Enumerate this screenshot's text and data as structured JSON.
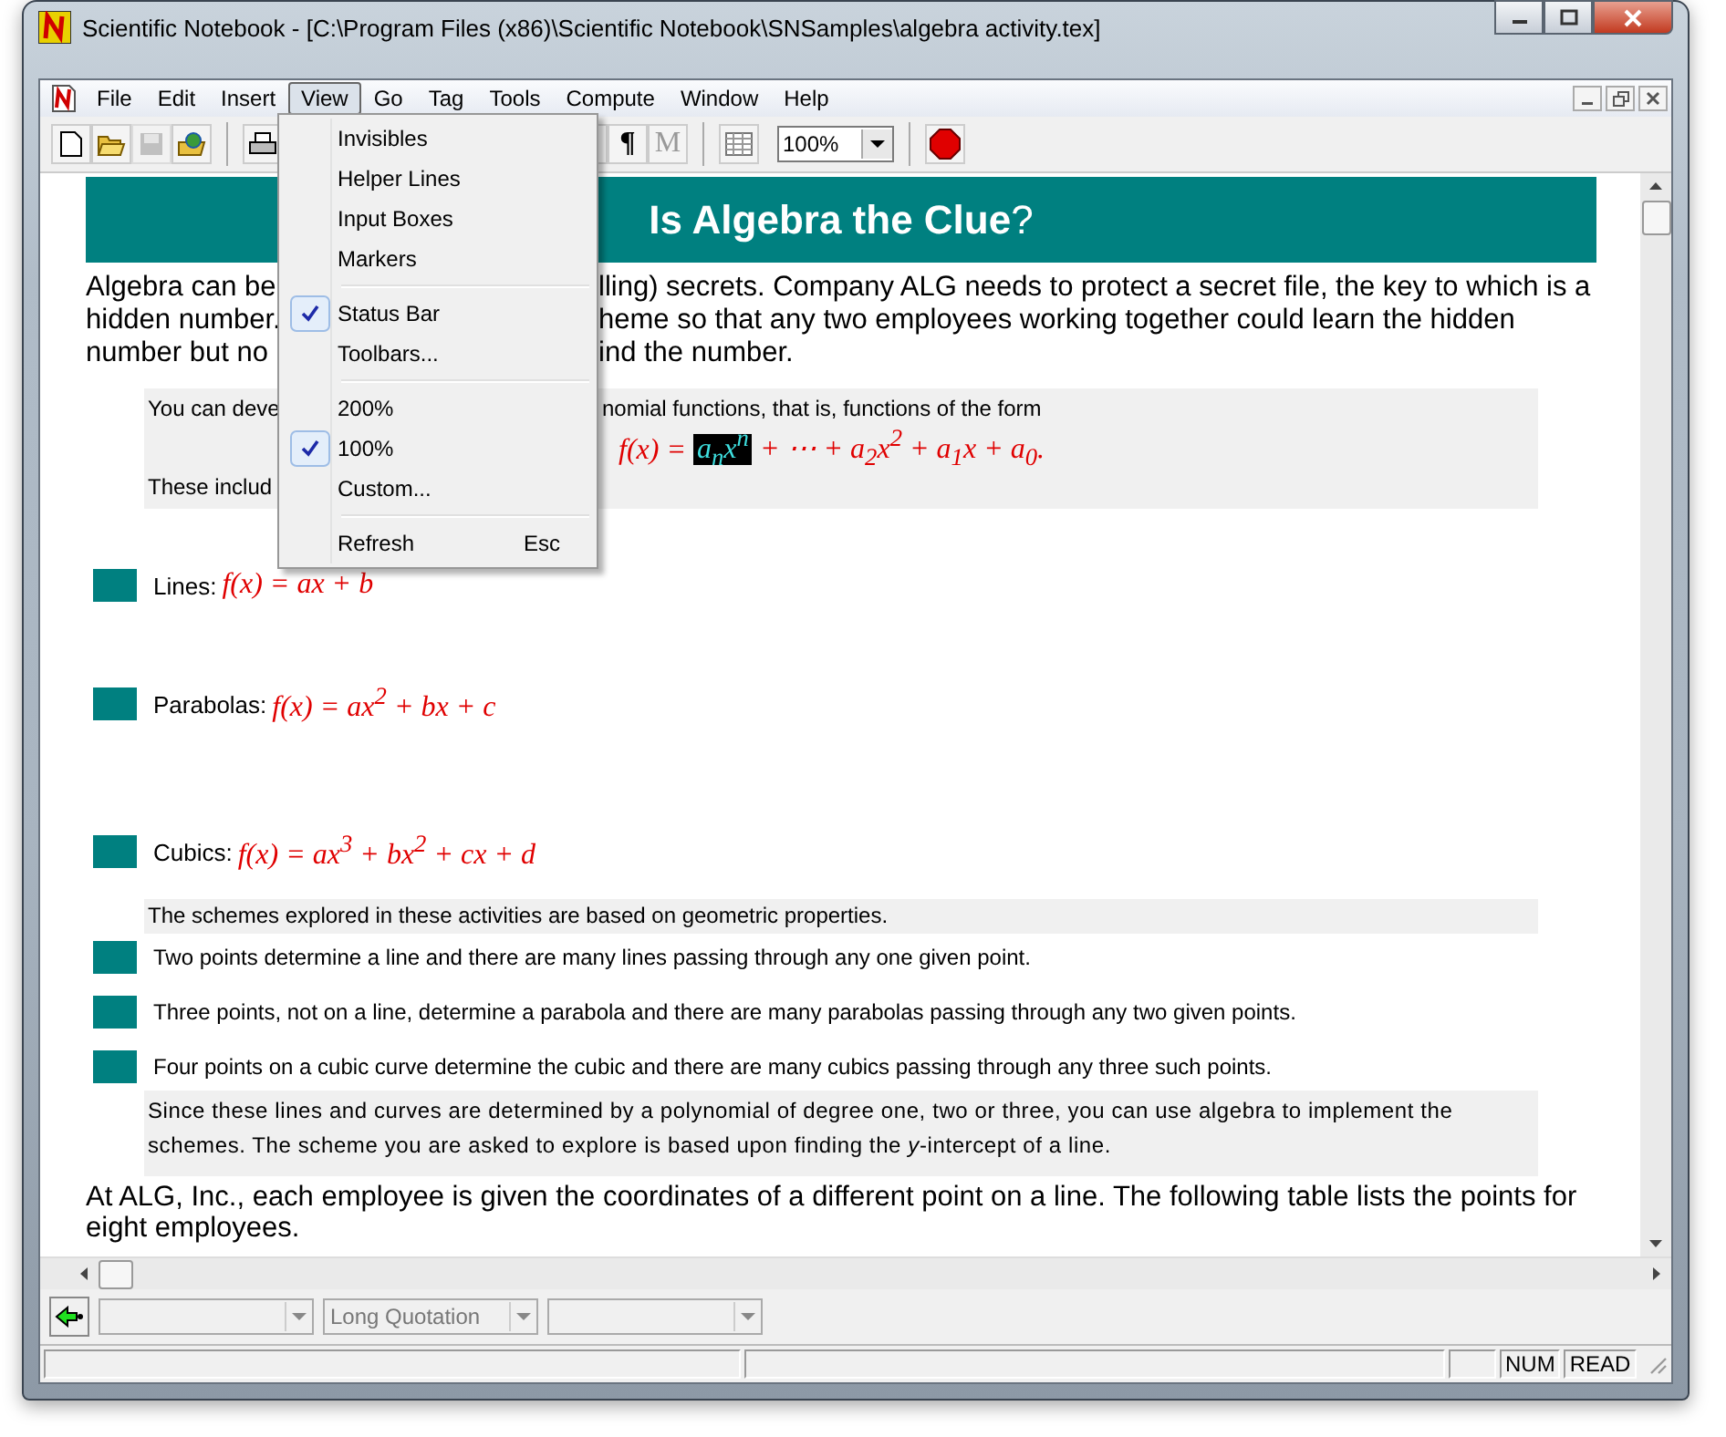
{
  "window": {
    "title": "Scientific Notebook - [C:\\Program Files (x86)\\Scientific Notebook\\SNSamples\\algebra activity.tex]"
  },
  "menu_bar": [
    {
      "label": "File",
      "selected": false
    },
    {
      "label": "Edit",
      "selected": false
    },
    {
      "label": "Insert",
      "selected": false
    },
    {
      "label": "View",
      "selected": true
    },
    {
      "label": "Go",
      "selected": false
    },
    {
      "label": "Tag",
      "selected": false
    },
    {
      "label": "Tools",
      "selected": false
    },
    {
      "label": "Compute",
      "selected": false
    },
    {
      "label": "Window",
      "selected": false
    },
    {
      "label": "Help",
      "selected": false
    }
  ],
  "toolbar": {
    "save_disabled": true,
    "text_buttons": [
      {
        "label": "¶",
        "disabled": false
      },
      {
        "label": "M",
        "disabled": true
      }
    ],
    "zoom": "100%"
  },
  "view_menu": {
    "groups": [
      [
        {
          "label": "Invisibles",
          "checked": false
        },
        {
          "label": "Helper Lines",
          "checked": false
        },
        {
          "label": "Input Boxes",
          "checked": false
        },
        {
          "label": "Markers",
          "checked": false
        }
      ],
      [
        {
          "label": "Status Bar",
          "checked": true
        },
        {
          "label": "Toolbars...",
          "checked": false
        }
      ],
      [
        {
          "label": "200%",
          "checked": false
        },
        {
          "label": "100%",
          "checked": true
        },
        {
          "label": "Custom...",
          "checked": false
        }
      ],
      [
        {
          "label": "Refresh",
          "checked": false,
          "shortcut": "Esc"
        }
      ]
    ]
  },
  "document": {
    "heading": "**Is Algebra the Clue**?",
    "intro": [
      {
        "left": "Algebra can be",
        "right": "lling) secrets. Company ALG needs to protect a secret file, the key to which is a"
      },
      {
        "left": "hidden number.",
        "right": "heme so that any two employees working together could learn the hidden"
      },
      {
        "left": "number but no",
        "right": "ind the number."
      }
    ],
    "note_box": {
      "line": {
        "left": "You can deve",
        "right": "nomial functions, that is, functions of the form"
      },
      "formula": [
        {
          "text": "f(x) = ",
          "selected": false
        },
        {
          "text": "a$_{n}$x$^{n}$",
          "selected": true
        },
        {
          "text": " + ⋯ + a$_{2}$x$^{2}$ + a$_{1}$x + a$_{0}$.",
          "selected": false
        }
      ],
      "after": "These includ"
    },
    "families": [
      {
        "label": "Lines:",
        "formula": "f(x) = ax + b"
      },
      {
        "label": "Parabolas:",
        "formula": "f(x) = ax$^{2}$ + bx + c"
      },
      {
        "label": "Cubics:",
        "formula": "f(x) = ax$^{3}$ + bx$^{2}$ + cx + d"
      }
    ],
    "schemes_note": "The schemes explored in these activities are based on geometric properties.",
    "schemes": [
      "Two points determine a line and there are many lines passing through any one given point.",
      "Three points, not on a line, determine a parabola and there are many parabolas passing through any two given points.",
      "Four points on a cubic curve determine the cubic and there are many cubics passing through any three such points."
    ],
    "since_note": "Since these lines and curves are determined by a polynomial of degree one, two or three, you can use algebra to implement the schemes. The scheme you are asked to explore is based upon finding the *y*-intercept of a line.",
    "closing": "At ALG, Inc., each employee is given the coordinates of a different point on a line. The following table lists the points for eight employees."
  },
  "tag_bar": {
    "section_tag": "Long Quotation"
  },
  "status_bar": {
    "indicators": [
      "NUM",
      "READ"
    ]
  }
}
